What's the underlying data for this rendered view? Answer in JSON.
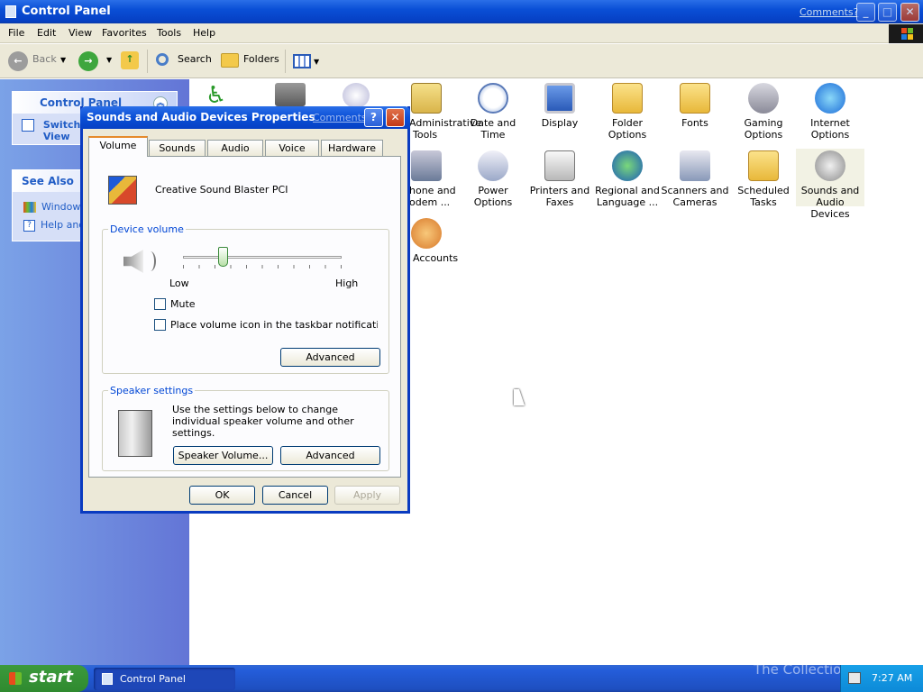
{
  "window": {
    "title": "Control Panel",
    "comments": "Comments?"
  },
  "menu": [
    "File",
    "Edit",
    "View",
    "Favorites",
    "Tools",
    "Help"
  ],
  "toolbar": {
    "back": "Back",
    "search": "Search",
    "folders": "Folders"
  },
  "left": {
    "panel_title": "Control Panel",
    "switch_view": "Switch to Category View",
    "switch_line1": "Switch",
    "switch_line2": "View",
    "see_also": "See Also",
    "links": [
      "Windows",
      "Help and"
    ]
  },
  "icons": [
    {
      "label": "Administrative Tools",
      "l1": "Administrative",
      "l2": "Tools"
    },
    {
      "label": "Date and Time",
      "l1": "Date and Time",
      "l2": ""
    },
    {
      "label": "Display",
      "l1": "Display",
      "l2": ""
    },
    {
      "label": "Folder Options",
      "l1": "Folder Options",
      "l2": ""
    },
    {
      "label": "Fonts",
      "l1": "Fonts",
      "l2": ""
    },
    {
      "label": "Gaming Options",
      "l1": "Gaming",
      "l2": "Options"
    },
    {
      "label": "Internet Options",
      "l1": "Internet",
      "l2": "Options"
    },
    {
      "label": "Phone and Modem ...",
      "l1": "hone and",
      "l2": "odem ..."
    },
    {
      "label": "Power Options",
      "l1": "Power Options",
      "l2": ""
    },
    {
      "label": "Printers and Faxes",
      "l1": "Printers and",
      "l2": "Faxes"
    },
    {
      "label": "Regional and Language ...",
      "l1": "Regional and",
      "l2": "Language ..."
    },
    {
      "label": "Scanners and Cameras",
      "l1": "Scanners and",
      "l2": "Cameras"
    },
    {
      "label": "Scheduled Tasks",
      "l1": "Scheduled",
      "l2": "Tasks"
    },
    {
      "label": "Sounds and Audio Devices",
      "l1": "Sounds and",
      "l2": "Audio Devices"
    },
    {
      "label": "User Accounts",
      "l1": "r Accounts",
      "l2": ""
    }
  ],
  "dialog": {
    "title": "Sounds and Audio Devices Properties",
    "comments": "Comments?",
    "tabs": [
      "Volume",
      "Sounds",
      "Audio",
      "Voice",
      "Hardware"
    ],
    "device_name": "Creative Sound Blaster PCI",
    "device_volume_label": "Device volume",
    "slider_low": "Low",
    "slider_high": "High",
    "volume_level": 0.25,
    "mute_label": "Mute",
    "mute_checked": false,
    "taskbar_icon_label": "Place volume icon in the taskbar notification area",
    "taskbar_icon_checked": false,
    "advanced_label": "Advanced",
    "speaker_settings_label": "Speaker settings",
    "speaker_desc": "Use the settings below to change individual speaker volume and other settings.",
    "speaker_volume_label": "Speaker Volume...",
    "speaker_advanced_label": "Advanced",
    "ok_label": "OK",
    "cancel_label": "Cancel",
    "apply_label": "Apply"
  },
  "taskbar": {
    "start": "start",
    "task": "Control Panel",
    "time": "7:27 AM",
    "watermark": "The Collection Book"
  }
}
